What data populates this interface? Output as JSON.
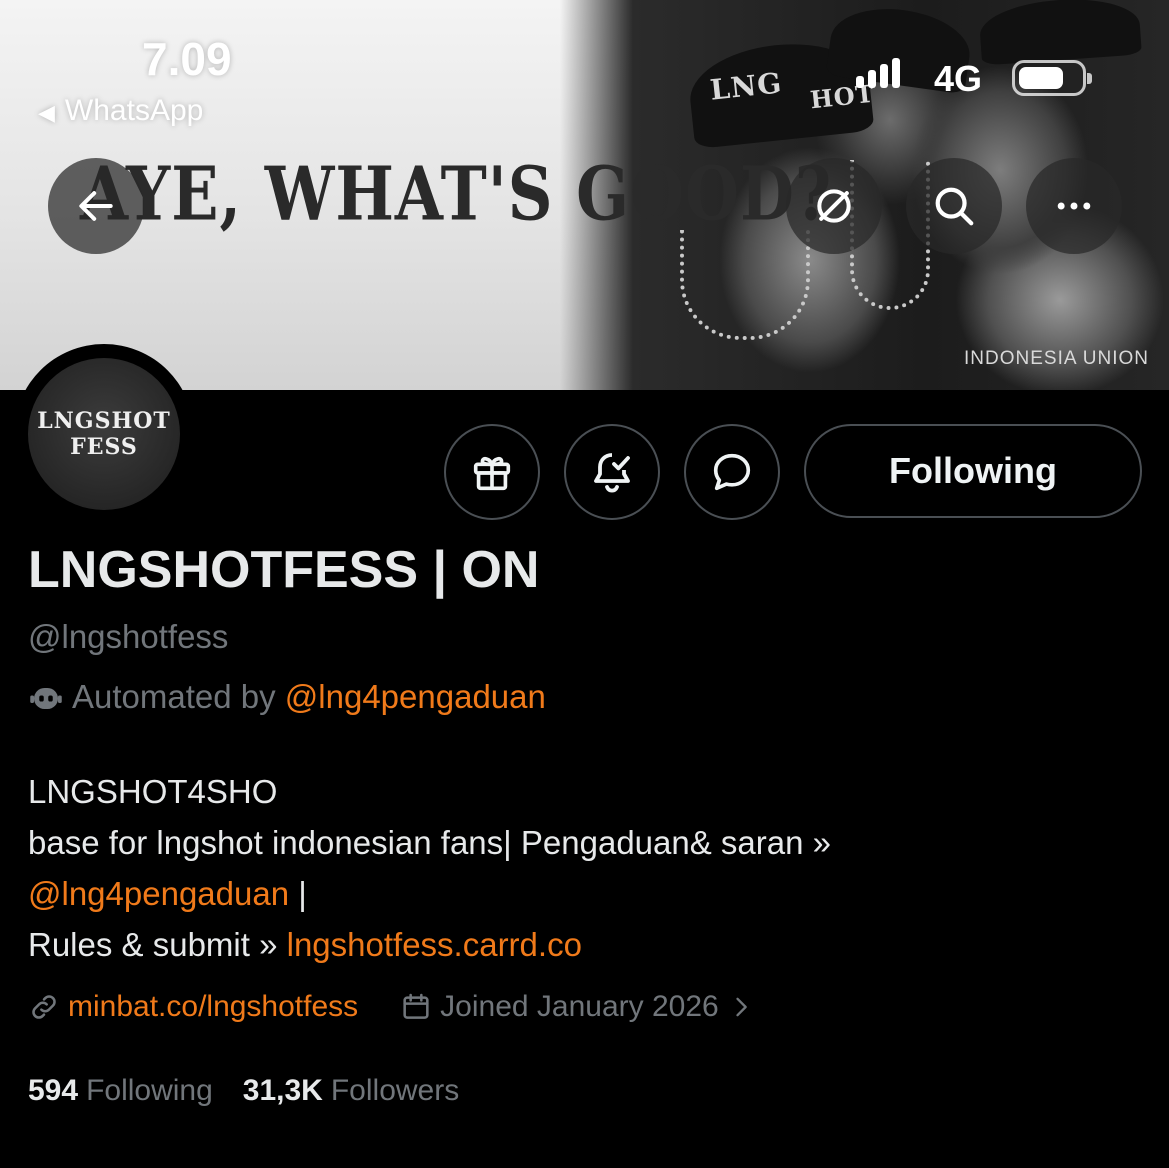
{
  "status_bar": {
    "time": "7.09",
    "back_app": "WhatsApp",
    "network": "4G"
  },
  "banner": {
    "slogan": "AYE, WHAT'S GOOD?",
    "cap_text_1": "LNG",
    "cap_text_2": "HOT",
    "watermark": "INDONESIA UNION"
  },
  "header_actions": {
    "back_icon": "arrow-left-icon",
    "grok_icon": "slashed-circle-icon",
    "search_icon": "search-icon",
    "more_icon": "more-dots-icon"
  },
  "avatar": {
    "line1": "LNGSHOT",
    "line2": "FESS"
  },
  "profile_actions": {
    "gift_icon": "gift-icon",
    "notify_icon": "bell-check-icon",
    "message_icon": "message-bubble-icon",
    "follow_label": "Following"
  },
  "profile": {
    "display_name": "LNGSHOTFESS | ON",
    "handle": "@lngshotfess",
    "automated_prefix": "Automated by",
    "automated_by": "@lng4pengaduan",
    "bio_line1": "LNGSHOT4SHO",
    "bio_line2": "base for lngshot indonesian fans| Pengaduan& saran »",
    "bio_mention": "@lng4pengaduan",
    "bio_mention_suffix": " |",
    "bio_line4_prefix": "Rules & submit » ",
    "bio_link": "lngshotfess.carrd.co",
    "website": "minbat.co/lngshotfess",
    "joined": "Joined January 2026",
    "following_count": "594",
    "following_label": "Following",
    "followers_count": "31,3K",
    "followers_label": "Followers"
  },
  "colors": {
    "accent": "#f07a1a",
    "muted": "#71767b",
    "text": "#e7e9ea",
    "background": "#000000"
  }
}
